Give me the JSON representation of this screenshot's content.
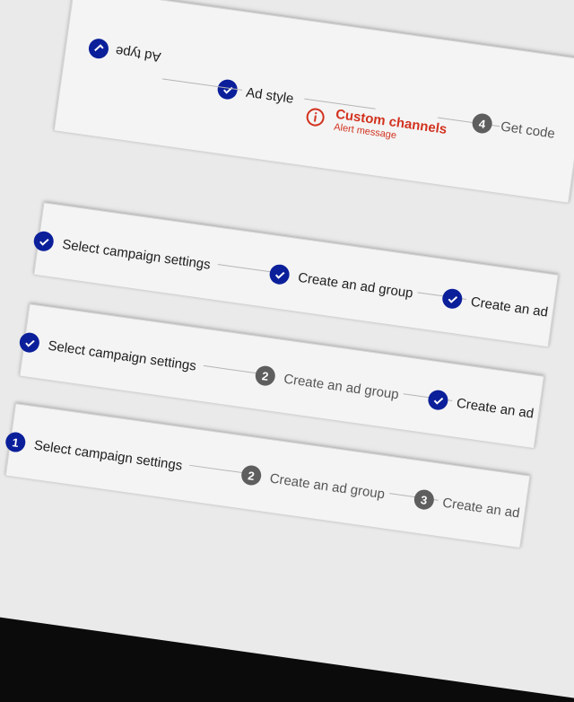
{
  "stepper_top": {
    "steps": [
      {
        "label": "Ad type",
        "state": "done",
        "icon": "check-icon"
      },
      {
        "label": "Ad style",
        "state": "done",
        "icon": "check-icon"
      },
      {
        "label": "Custom channels",
        "sublabel": "Alert message",
        "state": "error",
        "icon": "error-icon"
      },
      {
        "label": "Get code",
        "number": "4",
        "state": "pending"
      }
    ]
  },
  "stepper_a": {
    "steps": [
      {
        "label": "Select campaign settings",
        "state": "done",
        "icon": "check-icon"
      },
      {
        "label": "Create an ad group",
        "state": "done",
        "icon": "check-icon"
      },
      {
        "label": "Create an ad",
        "state": "done",
        "icon": "check-icon"
      }
    ]
  },
  "stepper_b": {
    "steps": [
      {
        "label": "Select campaign settings",
        "state": "done",
        "icon": "check-icon"
      },
      {
        "label": "Create an ad group",
        "number": "2",
        "state": "pending"
      },
      {
        "label": "Create an ad",
        "state": "done",
        "icon": "check-icon"
      }
    ]
  },
  "stepper_c": {
    "steps": [
      {
        "label": "Select campaign settings",
        "number": "1",
        "state": "active"
      },
      {
        "label": "Create an ad group",
        "number": "2",
        "state": "pending"
      },
      {
        "label": "Create an ad",
        "number": "3",
        "state": "pending"
      }
    ]
  },
  "colors": {
    "primary": "#0b1f9a",
    "error": "#d2321f",
    "pending": "#5e5e5e"
  }
}
